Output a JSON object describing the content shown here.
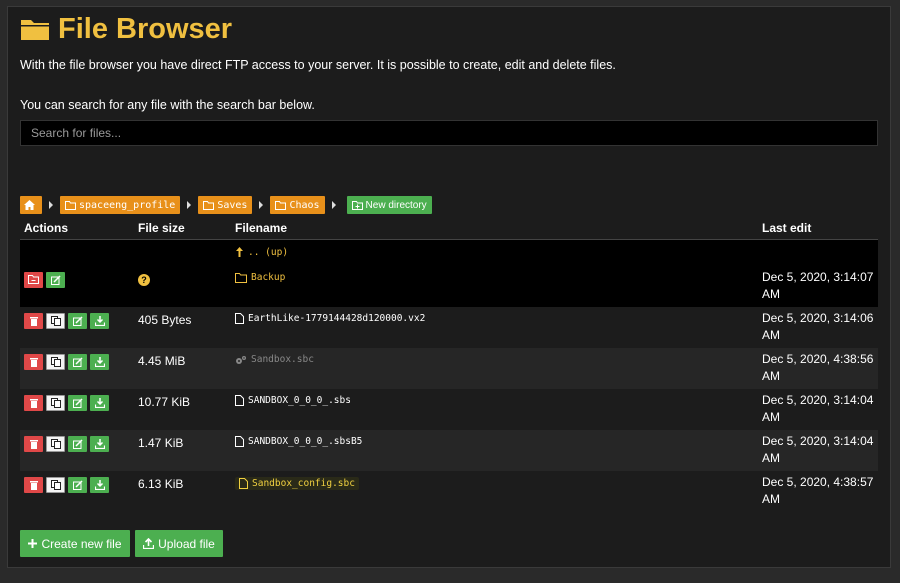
{
  "page": {
    "title": "File Browser",
    "description1": "With the file browser you have direct FTP access to your server. It is possible to create, edit and delete files.",
    "description2": "You can search for any file with the search bar below."
  },
  "search": {
    "placeholder": "Search for files..."
  },
  "breadcrumb": {
    "home_icon": "home-icon",
    "items": [
      "spaceeng_profile",
      "Saves",
      "Chaos"
    ],
    "new_directory_label": "New directory"
  },
  "table": {
    "headers": {
      "actions": "Actions",
      "size": "File size",
      "name": "Filename",
      "edit": "Last edit"
    },
    "up_label": ".. (up)",
    "rows": [
      {
        "type": "folder",
        "size": "",
        "name": "Backup",
        "edit": "Dec 5, 2020, 3:14:07 AM"
      },
      {
        "type": "file",
        "size": "405 Bytes",
        "name": "EarthLike-1779144428d120000.vx2",
        "edit": "Dec 5, 2020, 3:14:06 AM"
      },
      {
        "type": "gear",
        "size": "4.45 MiB",
        "name": "Sandbox.sbc",
        "edit": "Dec 5, 2020, 4:38:56 AM"
      },
      {
        "type": "file",
        "size": "10.77 KiB",
        "name": "SANDBOX_0_0_0_.sbs",
        "edit": "Dec 5, 2020, 3:14:04 AM"
      },
      {
        "type": "file",
        "size": "1.47 KiB",
        "name": "SANDBOX_0_0_0_.sbsB5",
        "edit": "Dec 5, 2020, 3:14:04 AM"
      },
      {
        "type": "highlight",
        "size": "6.13 KiB",
        "name": "Sandbox_config.sbc",
        "edit": "Dec 5, 2020, 4:38:57 AM"
      }
    ]
  },
  "buttons": {
    "create": "Create new file",
    "upload": "Upload file"
  },
  "colors": {
    "accent": "#f0c040",
    "orange": "#e8901a",
    "green": "#4caf50",
    "red": "#e04848"
  }
}
